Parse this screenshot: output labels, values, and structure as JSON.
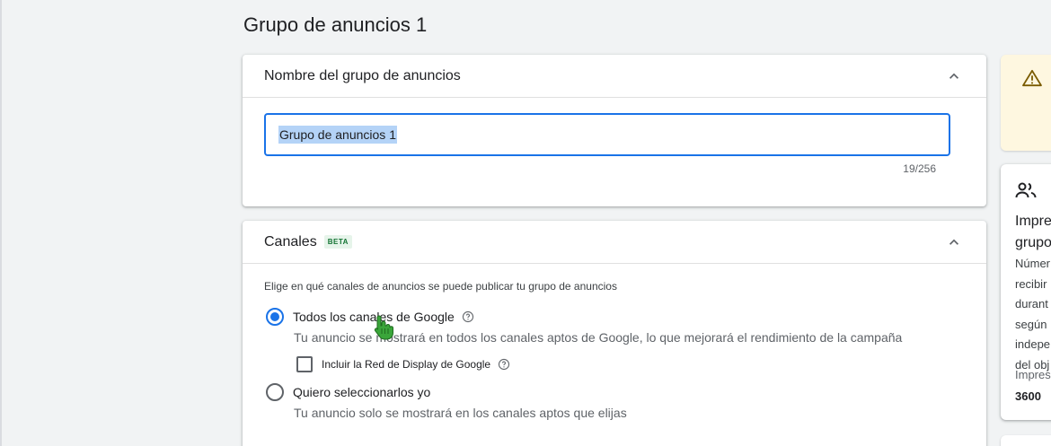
{
  "page": {
    "title": "Grupo de anuncios 1"
  },
  "name_section": {
    "title": "Nombre del grupo de anuncios",
    "input_value": "Grupo de anuncios 1",
    "counter": "19/256"
  },
  "channels_section": {
    "title": "Canales",
    "badge": "BETA",
    "description": "Elige en qué canales de anuncios se puede publicar tu grupo de anuncios",
    "option_all": {
      "label": "Todos los canales de Google",
      "sub": "Tu anuncio se mostrará en todos los canales aptos de Google, lo que mejorará el rendimiento de la campaña",
      "checked": true
    },
    "checkbox_display": {
      "label": "Incluir la Red de Display de Google",
      "checked": false
    },
    "option_select": {
      "label": "Quiero seleccionarlos yo",
      "sub": "Tu anuncio solo se mostrará en los canales aptos que elijas",
      "checked": false
    }
  },
  "right_panel": {
    "info_title_line1": "Impre",
    "info_title_line2": "grupo",
    "info_body": [
      "Númer",
      "recibir",
      "durant",
      "según",
      "indepe",
      "del obj"
    ],
    "info_label": "Impres",
    "info_value": "3600"
  },
  "colors": {
    "accent": "#1a73e8",
    "warning_bg": "#fef7e0",
    "beta_bg": "#e6f4ea",
    "beta_text": "#137333"
  }
}
